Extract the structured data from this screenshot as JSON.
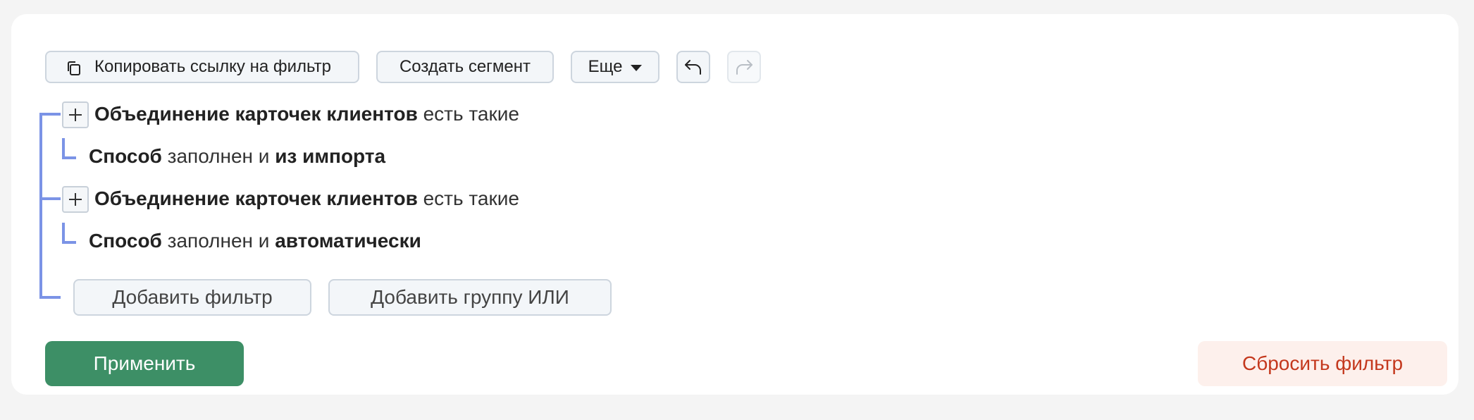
{
  "toolbar": {
    "copy_link_label": "Копировать ссылку на фильтр",
    "create_segment_label": "Создать сегмент",
    "more_label": "Еще"
  },
  "filters": [
    {
      "group_field": "Объединение карточек клиентов",
      "group_condition": "есть такие",
      "sub_field": "Способ",
      "sub_condition": "заполнен и",
      "sub_value": "из импорта"
    },
    {
      "group_field": "Объединение карточек клиентов",
      "group_condition": "есть такие",
      "sub_field": "Способ",
      "sub_condition": "заполнен и",
      "sub_value": "автоматически"
    }
  ],
  "actions": {
    "add_filter_label": "Добавить фильтр",
    "add_or_group_label": "Добавить группу ИЛИ",
    "apply_label": "Применить",
    "reset_label": "Сбросить фильтр"
  },
  "colors": {
    "tree_line": "#7b93e6",
    "apply_bg": "#3d8f66",
    "reset_text": "#c4381d",
    "reset_bg": "#fdf0ec"
  }
}
